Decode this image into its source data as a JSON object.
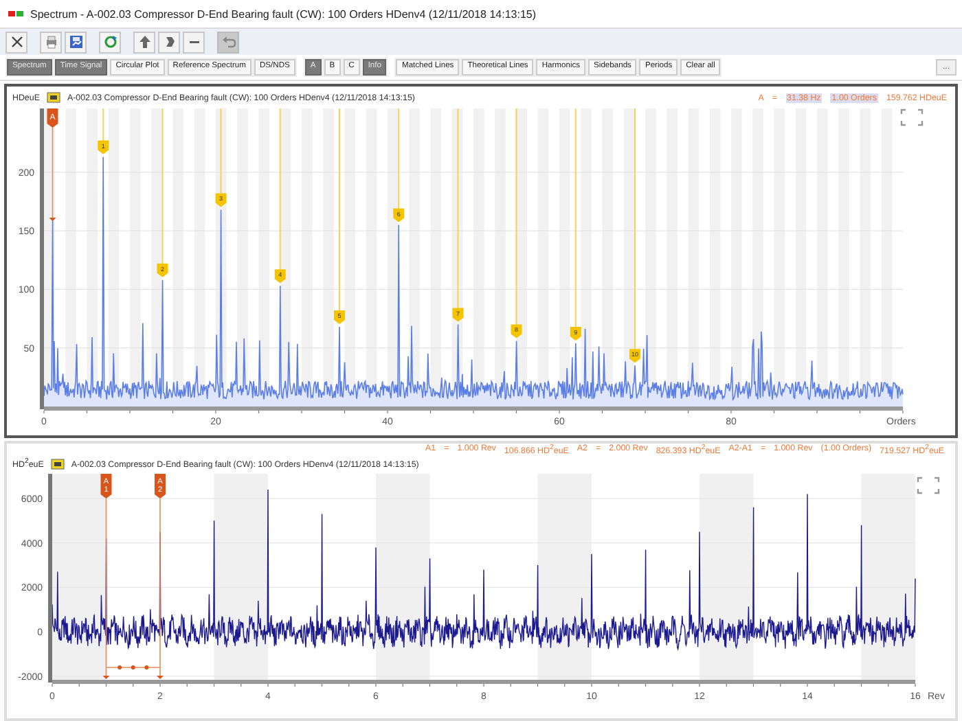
{
  "window": {
    "title": "Spectrum -  A-002.03  Compressor D-End Bearing fault (CW): 100 Orders HDenv4 (12/11/2018 14:13:15)"
  },
  "toolbar": [
    {
      "kind": "close",
      "disabled": false
    },
    {
      "kind": "print",
      "disabled": false
    },
    {
      "kind": "save",
      "disabled": false
    },
    {
      "kind": "refresh",
      "disabled": false
    },
    {
      "kind": "up",
      "disabled": false
    },
    {
      "kind": "down",
      "disabled": false
    },
    {
      "kind": "minus",
      "disabled": false
    },
    {
      "kind": "undo",
      "disabled": true
    }
  ],
  "tab_groups": [
    [
      {
        "label": "Spectrum",
        "selected": true
      },
      {
        "label": "Time Signal",
        "selected": true
      },
      {
        "label": "Circular Plot",
        "selected": false
      },
      {
        "label": "Reference Spectrum",
        "selected": false
      },
      {
        "label": "DS/NDS",
        "selected": false
      }
    ],
    [
      {
        "label": "A",
        "selected": true
      },
      {
        "label": "B",
        "selected": false
      },
      {
        "label": "C",
        "selected": false
      },
      {
        "label": "Info",
        "selected": true
      }
    ],
    [
      {
        "label": "Matched Lines",
        "selected": false
      },
      {
        "label": "Theoretical Lines",
        "selected": false
      },
      {
        "label": "Harmonics",
        "selected": false
      },
      {
        "label": "Sidebands",
        "selected": false
      },
      {
        "label": "Periods",
        "selected": false
      },
      {
        "label": "Clear all",
        "selected": false
      }
    ]
  ],
  "more_button": {
    "label": "..."
  },
  "spectrum": {
    "unit": "HDeuE",
    "title": "A-002.03  Compressor D-End Bearing fault (CW): 100 Orders HDenv4 (12/11/2018 14:13:15)",
    "readout": [
      {
        "text": "A",
        "highlighted": false
      },
      {
        "text": "=",
        "highlighted": false
      },
      {
        "text": "31.38 Hz",
        "highlighted": true
      },
      {
        "text": "1.00 Orders",
        "highlighted": true
      },
      {
        "text": "159.762 HDeuE",
        "highlighted": false
      }
    ],
    "cursor": {
      "label": "A"
    },
    "markers": [
      "1",
      "2",
      "3",
      "4",
      "5",
      "6",
      "7",
      "8",
      "9",
      "10"
    ],
    "yticks": [
      "200",
      "150",
      "100",
      "50"
    ],
    "xticks": [
      "0",
      "20",
      "40",
      "60",
      "80"
    ],
    "xlabel": "Orders"
  },
  "waveform": {
    "unit": "HD$^{2}$euE",
    "title": "A-002.03  Compressor D-End Bearing fault (CW): 100 Orders HDenv4 (12/11/2018 14:13:15)",
    "readout": [
      {
        "text": "A1"
      },
      {
        "text": "="
      },
      {
        "text": "1.000 Rev"
      },
      {
        "text": "106.866 HD$^{2}$euE"
      },
      {
        "text": "A2"
      },
      {
        "text": "="
      },
      {
        "text": "2.000 Rev"
      },
      {
        "text": "826.393 HD$^{2}$euE"
      },
      {
        "text": "A2-A1"
      },
      {
        "text": "="
      },
      {
        "text": "1.000 Rev"
      },
      {
        "text": "(1.00 Orders)"
      },
      {
        "text": "719.527 HD$^{2}$euE"
      }
    ],
    "cursors": [
      {
        "label": "A1"
      },
      {
        "label": "A2"
      }
    ],
    "yticks": [
      "6000",
      "4000",
      "2000",
      "0",
      "-2000"
    ],
    "xticks": [
      "0",
      "2",
      "4",
      "6",
      "8",
      "10",
      "12",
      "14",
      "16"
    ],
    "xlabel": "Rev"
  }
}
